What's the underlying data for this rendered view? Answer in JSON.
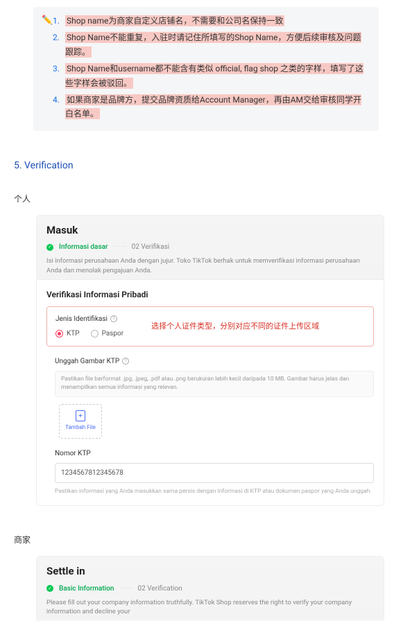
{
  "callout": {
    "items": [
      "Shop name为商家自定义店铺名，不需要和公司名保持一致",
      "Shop Name不能重复，入驻时请记住所填写的Shop Name，方便后续审核及问题跟踪。",
      "Shop Name和username都不能含有类似 official, flag shop 之类的字样，填写了这些字样会被驳回。",
      "如果商家是品牌方，提交品牌资质给Account Manager，再由AM交给审核同学开白名单。"
    ]
  },
  "section": {
    "num": "5.",
    "title": "Verification"
  },
  "personal_label": "个人",
  "merchant_label": "商家",
  "sc1": {
    "title": "Masuk",
    "step1": "Informasi dasar",
    "step2": "02 Verifikasi",
    "desc": "Isi informasi perusahaan Anda dengan jujur. Toko TikTok berhak untuk memverifikasi informasi perusahaan Anda dan menolak pengajuan Anda.",
    "verif_heading": "Verifikasi Informasi Pribadi",
    "id_label": "Jenis Identifikasi",
    "radio_ktp": "KTP",
    "radio_paspor": "Paspor",
    "red_note": "选择个人证件类型，分别对应不同的证件上传区域",
    "upload_label": "Unggah Gambar KTP",
    "upload_hint": "Pastikan file berformat .jpg, .jpeg, .pdf atau .png berukuran lebih kecil daripada 10 MB. Gambar harus jelas dan menampilkan semua informasi yang relevan.",
    "upload_btn": "Tambah File",
    "nomor_label": "Nomor KTP",
    "nomor_value": "1234567812345678",
    "nomor_hint": "Pastikan informasi yang Anda masukkan sama persis dengan informasi di KTP atau dokumen paspor yang Anda unggah."
  },
  "sc2": {
    "title": "Settle in",
    "step1": "Basic Information",
    "step2": "02 Verification",
    "desc": "Please fill out your company information truthfully. TikTok Shop reserves the right to verify your company information and decline your"
  }
}
